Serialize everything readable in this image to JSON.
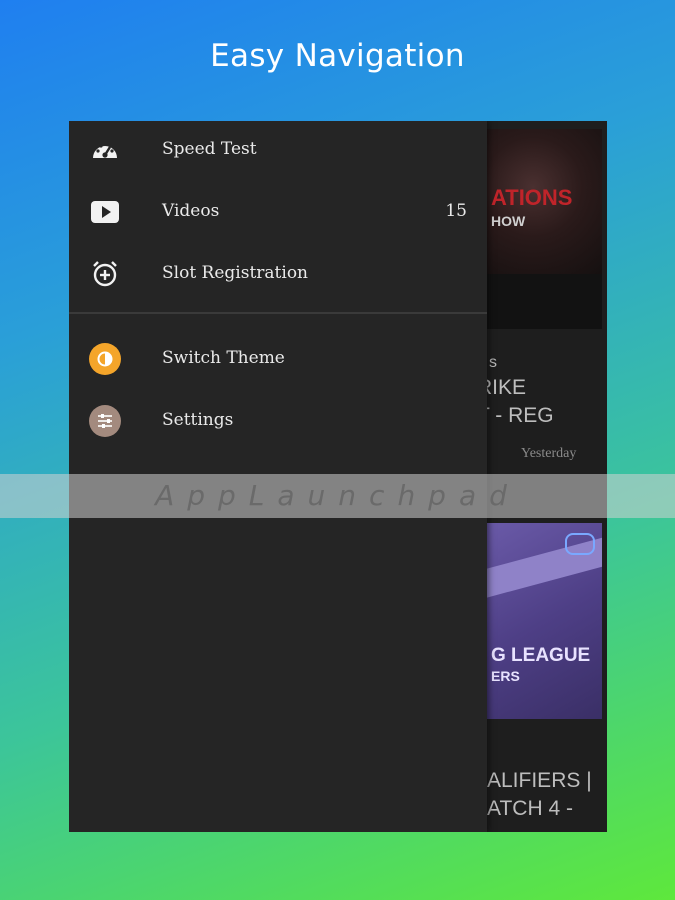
{
  "headline": "Easy Navigation",
  "drawer": {
    "items": [
      {
        "label": "Speed Test",
        "icon": "speedometer-icon"
      },
      {
        "label": "Videos",
        "icon": "play-icon",
        "count": "15"
      },
      {
        "label": "Slot Registration",
        "icon": "alarm-add-icon"
      },
      {
        "label": "Switch Theme",
        "icon": "theme-icon",
        "icon_color": "#f4a52a"
      },
      {
        "label": "Settings",
        "icon": "sliders-icon",
        "icon_color": "#a38a7e"
      }
    ]
  },
  "feed": {
    "thumb1_title": "ATIONS",
    "thumb1_subtitle": "HOW",
    "card1_prefix": "s",
    "card1_line1": "RIKE",
    "card1_line2": "T - REG",
    "card1_time": "Yesterday",
    "thumb2_line1": "G LEAGUE",
    "thumb2_line2": "ERS",
    "card2_line1": "ALIFIERS |",
    "card2_line2": "ATCH 4 -"
  },
  "watermark": "AppLaunchpad"
}
